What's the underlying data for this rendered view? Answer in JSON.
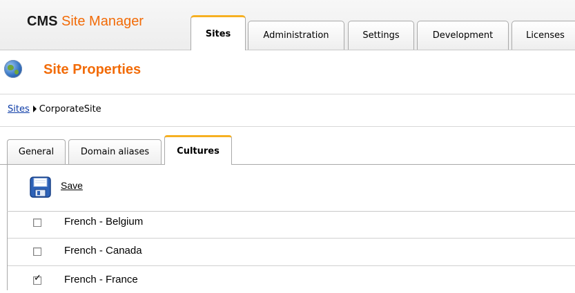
{
  "header": {
    "title_bold": "CMS",
    "title_rest": "Site Manager",
    "tabs": [
      "Sites",
      "Administration",
      "Settings",
      "Development",
      "Licenses"
    ],
    "active_tab": "Sites"
  },
  "page": {
    "title": "Site Properties"
  },
  "breadcrumb": {
    "link": "Sites",
    "current": "CorporateSite"
  },
  "subtabs": [
    "General",
    "Domain aliases",
    "Cultures"
  ],
  "active_subtab": "Cultures",
  "toolbar": {
    "save_label": "Save"
  },
  "cultures": [
    {
      "label": "French - Belgium",
      "checked": false
    },
    {
      "label": "French - Canada",
      "checked": false
    },
    {
      "label": "French - France",
      "checked": true
    }
  ]
}
